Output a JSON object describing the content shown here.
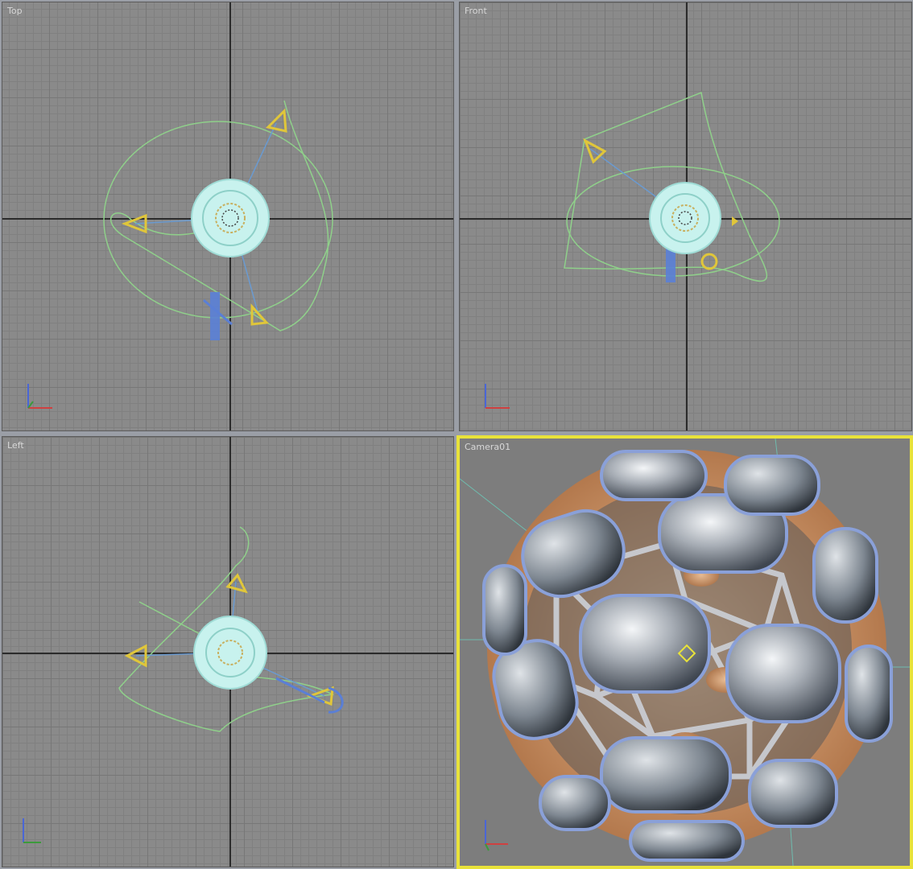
{
  "viewports": {
    "top": {
      "label": "Top"
    },
    "front": {
      "label": "Front"
    },
    "left": {
      "label": "Left"
    },
    "camera": {
      "label": "Camera01"
    }
  },
  "colors": {
    "active_border": "#e8e23a",
    "spline": "#8fd08a",
    "camera_target": "#e0c63a",
    "light_helper": "#5a7fd6",
    "ball_wire": "#b7f0e8",
    "grid": "#8a8a8a"
  },
  "icons": {
    "axis_gizmo": "axis-tripod-icon",
    "camera": "camera-cone-icon",
    "light": "spotlight-icon"
  }
}
